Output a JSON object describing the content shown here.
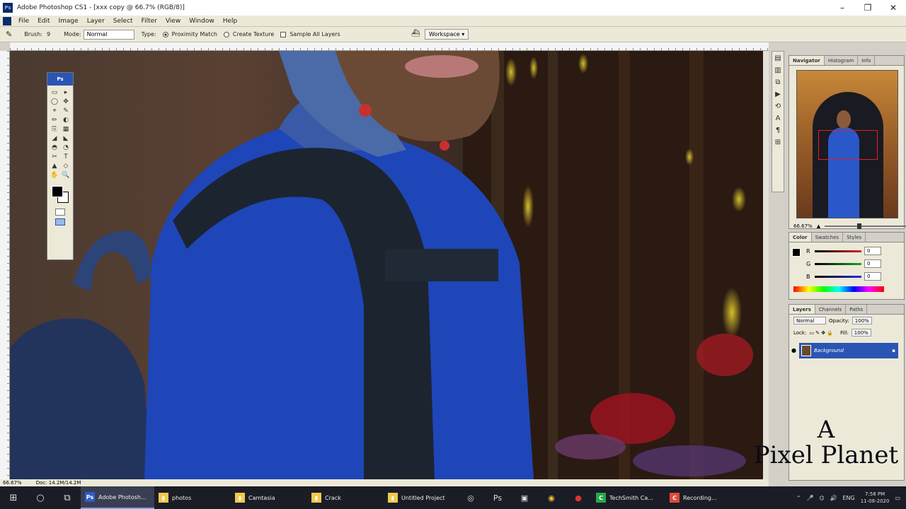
{
  "window": {
    "title": "Adobe Photoshop CS1 - [xxx copy @ 66.7% (RGB/8)]",
    "minimize": "–",
    "restore": "❐",
    "close": "✕"
  },
  "menu": [
    "File",
    "Edit",
    "Image",
    "Layer",
    "Select",
    "Filter",
    "View",
    "Window",
    "Help"
  ],
  "options": {
    "brush_label": "Brush:",
    "brush_size": "9",
    "mode_label": "Mode:",
    "mode_value": "Normal",
    "type_label": "Type:",
    "proximity": "Proximity Match",
    "texture": "Create Texture",
    "sample_all": "Sample All Layers",
    "workspace": "Workspace ▾"
  },
  "tools": {
    "header": "Ps",
    "icons": [
      "▭",
      "▸",
      "◯",
      "✥",
      "⌖",
      "✎",
      "✏",
      "◐",
      "⎘",
      "▦",
      "◢",
      "◣",
      "◓",
      "◔",
      "✂",
      "T",
      "▲",
      "◇",
      "✋",
      "🔍"
    ]
  },
  "status": {
    "zoom": "66.67%",
    "doc": "Doc: 14.2M/14.2M"
  },
  "navigator": {
    "tabs": [
      "Navigator",
      "Histogram",
      "Info"
    ],
    "zoom": "66.67%"
  },
  "color": {
    "tabs": [
      "Color",
      "Swatches",
      "Styles"
    ],
    "channels": [
      {
        "name": "R",
        "value": "0",
        "color": "#e02020"
      },
      {
        "name": "G",
        "value": "0",
        "color": "#20a020"
      },
      {
        "name": "B",
        "value": "0",
        "color": "#2030e0"
      }
    ]
  },
  "layers": {
    "tabs": [
      "Layers",
      "Channels",
      "Paths"
    ],
    "blend": "Normal",
    "opacity_label": "Opacity:",
    "opacity": "100%",
    "lock_label": "Lock:",
    "fill_label": "Fill:",
    "fill": "100%",
    "layer_name": "Background"
  },
  "watermark": {
    "line1": "A",
    "line2": "Pixel Planet"
  },
  "taskbar": {
    "apps": [
      {
        "label": "Adobe Photosh...",
        "icon": "Ps",
        "color": "#2b5cc8",
        "active": true
      },
      {
        "label": "photos",
        "icon": "▮",
        "color": "#f2c94c",
        "active": false
      },
      {
        "label": "Camtasia",
        "icon": "▮",
        "color": "#f2c94c",
        "active": false
      },
      {
        "label": "Crack",
        "icon": "▮",
        "color": "#f2c94c",
        "active": false
      },
      {
        "label": "Untitled Project",
        "icon": "▮",
        "color": "#f2c94c",
        "active": false
      },
      {
        "label": "TechSmith Ca...",
        "icon": "C",
        "color": "#29a64a",
        "active": false
      },
      {
        "label": "Recording...",
        "icon": "C",
        "color": "#e04a3a",
        "active": false
      }
    ],
    "lang": "ENG",
    "time": "7:58 PM",
    "date": "11-08-2020"
  }
}
